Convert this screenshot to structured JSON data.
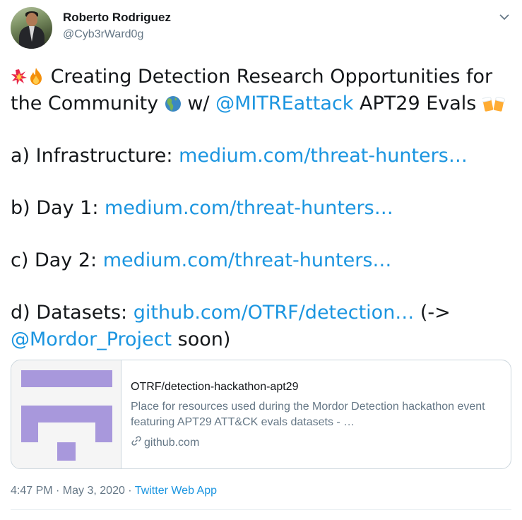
{
  "author": {
    "name": "Roberto Rodriguez",
    "handle": "@Cyb3rWard0g"
  },
  "tweet": {
    "line1_text": " Creating Detection Research Opportunities for",
    "line2_a": "the Community ",
    "line2_b": " w/ ",
    "line2_mention": "@MITREattack",
    "line2_c": " APT29 Evals ",
    "a_label": "a) Infrastructure: ",
    "a_link": "medium.com/threat-hunters…",
    "b_label": "b) Day 1: ",
    "b_link": "medium.com/threat-hunters…",
    "c_label": "c) Day 2: ",
    "c_link": "medium.com/threat-hunters…",
    "d_label": "d) Datasets: ",
    "d_link": "github.com/OTRF/detection…",
    "d_after": " (->",
    "d_mention": "@Mordor_Project",
    "d_end": "  soon)"
  },
  "card": {
    "title": "OTRF/detection-hackathon-apt29",
    "description": "Place for resources used during the Mordor Detection hackathon event featuring APT29 ATT&CK evals datasets - …",
    "domain": "github.com"
  },
  "meta": {
    "time": "4:47 PM · May 3, 2020 · ",
    "source": "Twitter Web App"
  },
  "colors": {
    "link": "#1b95e0",
    "secondary_text": "#657786",
    "logo_purple": "#a898dc"
  },
  "icons": [
    "collision-emoji",
    "fire-emoji",
    "globe-americas-emoji",
    "beer-mugs-emoji",
    "chevron-down-icon",
    "link-icon"
  ]
}
